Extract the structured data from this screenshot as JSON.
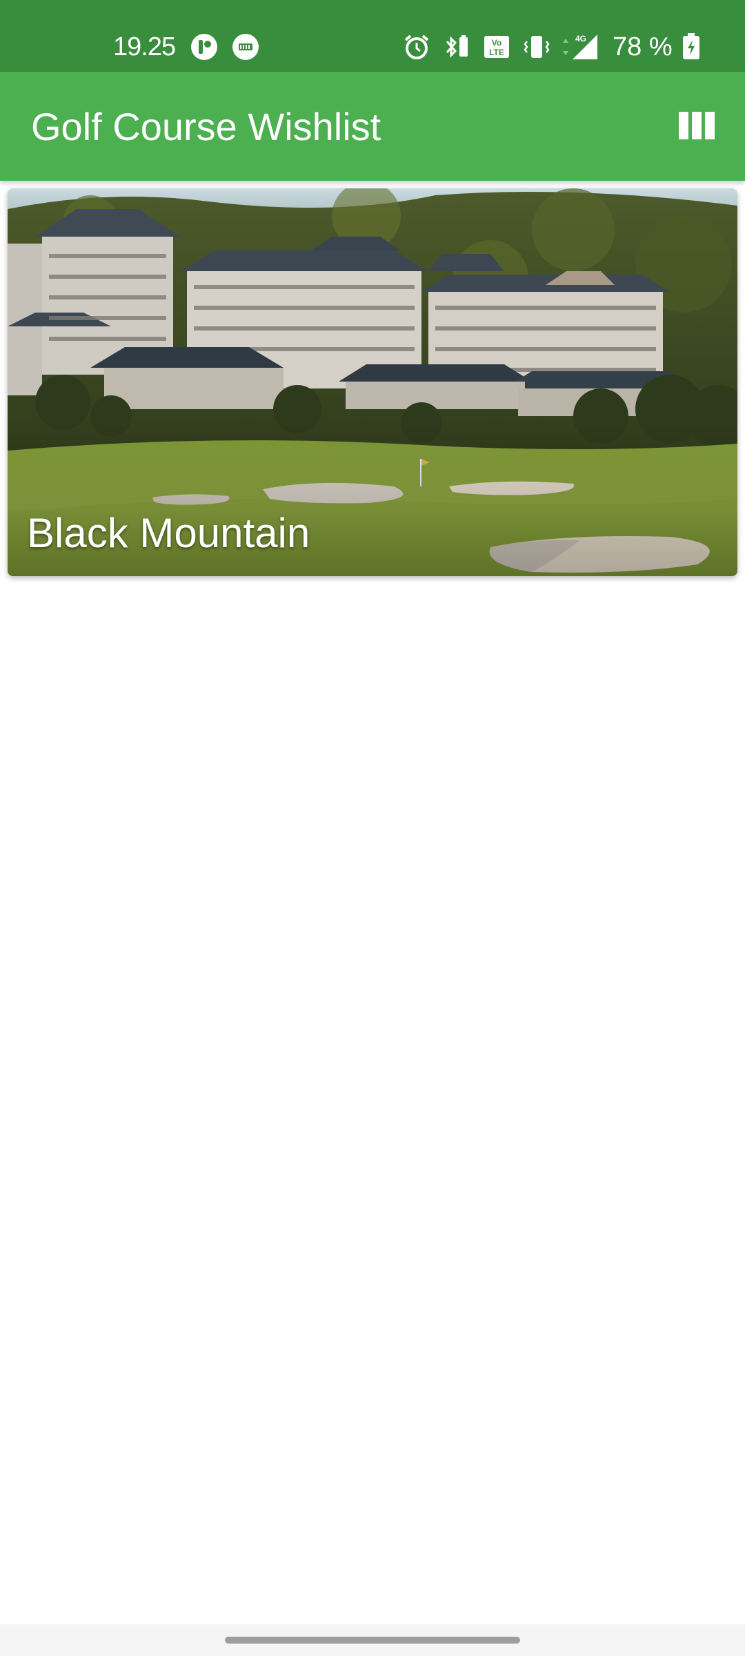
{
  "status_bar": {
    "time": "19.25",
    "battery_text": "78 %",
    "network_label": "4G",
    "volte_label": "Vo LTE",
    "icons": [
      "circle-app-icon",
      "media-app-icon",
      "alarm-icon",
      "bluetooth-battery-icon",
      "volte-icon",
      "vibrate-icon",
      "signal-4g-icon",
      "battery-charging-icon"
    ]
  },
  "app_bar": {
    "title": "Golf Course Wishlist",
    "action_icon": "view-column-icon"
  },
  "courses": [
    {
      "name": "Black Mountain"
    }
  ],
  "colors": {
    "status_bar": "#388e3c",
    "app_bar": "#4caf50",
    "text_on_primary": "#ffffff",
    "background": "#ffffff"
  }
}
